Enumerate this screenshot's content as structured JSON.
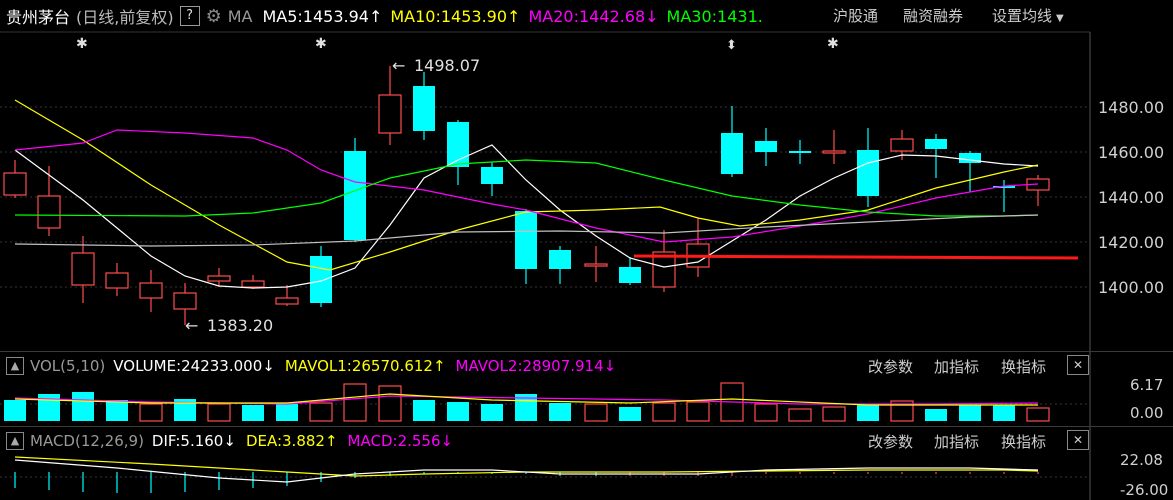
{
  "header": {
    "stock_name": "贵州茅台",
    "period": "(日线,前复权)",
    "help": "?",
    "ma_label": "MA",
    "ma5": "MA5:1453.94",
    "ma5_arrow": "↑",
    "ma10": "MA10:1453.90",
    "ma10_arrow": "↑",
    "ma20": "MA20:1442.68",
    "ma20_arrow": "↓",
    "ma30": "MA30:1431.",
    "menu_hgt": "沪股通",
    "menu_margin": "融资融券",
    "menu_settings": "设置均线"
  },
  "price_axis": [
    "1480.00",
    "1460.00",
    "1440.00",
    "1420.00",
    "1400.00"
  ],
  "annotations": {
    "high": "1498.07",
    "low": "1383.20"
  },
  "volume": {
    "label": "VOL(5,10)",
    "volume": "VOLUME:24233.000",
    "volume_arrow": "↓",
    "mavol1": "MAVOL1:26570.612",
    "mavol1_arrow": "↑",
    "mavol2": "MAVOL2:28907.914",
    "mavol2_arrow": "↓",
    "axis_top": "6.17",
    "axis_bottom": "0.00"
  },
  "macd": {
    "label": "MACD(12,26,9)",
    "dif": "DIF:5.160",
    "dif_arrow": "↓",
    "dea": "DEA:3.882",
    "dea_arrow": "↑",
    "macd": "MACD:2.556",
    "macd_arrow": "↓",
    "axis_top": "22.08",
    "axis_bottom": "-26.00"
  },
  "panel_buttons": {
    "change_params": "改参数",
    "add_indicator": "加指标",
    "switch_indicator": "换指标",
    "close": "✕"
  },
  "colors": {
    "up": "#ff4d4d",
    "down": "#00ffff",
    "ma5": "#ffffff",
    "ma10": "#ffff00",
    "ma20": "#ff00ff",
    "ma30": "#00ff00",
    "support_line": "#ff1a1a",
    "ma60": "#c0c0c0"
  }
}
